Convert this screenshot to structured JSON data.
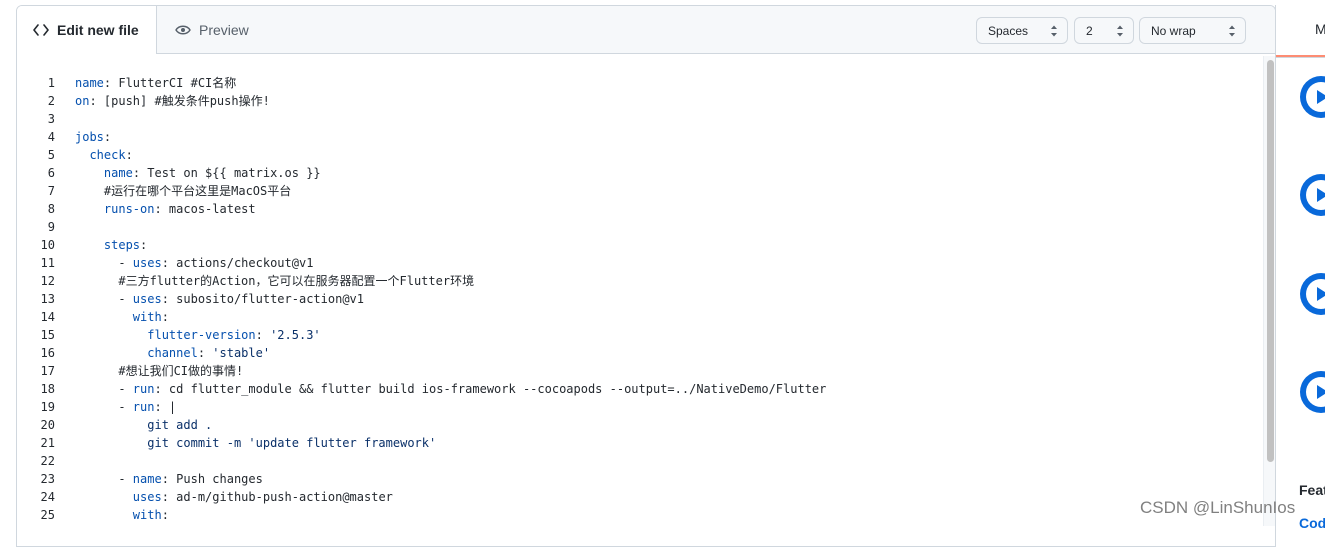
{
  "tabs": {
    "edit_label": "Edit new file",
    "preview_label": "Preview"
  },
  "options": {
    "indent_mode": "Spaces",
    "indent_size": "2",
    "wrap_mode": "No wrap"
  },
  "code_lines": [
    {
      "n": "1",
      "segs": [
        [
          "k",
          "name"
        ],
        [
          "t",
          ": FlutterCI #CI名称"
        ]
      ]
    },
    {
      "n": "2",
      "segs": [
        [
          "k",
          "on"
        ],
        [
          "t",
          ": [push] #触发条件push操作!"
        ]
      ]
    },
    {
      "n": "3",
      "segs": []
    },
    {
      "n": "4",
      "segs": [
        [
          "k",
          "jobs"
        ],
        [
          "t",
          ":"
        ]
      ]
    },
    {
      "n": "5",
      "segs": [
        [
          "t",
          "  "
        ],
        [
          "k",
          "check"
        ],
        [
          "t",
          ":"
        ]
      ]
    },
    {
      "n": "6",
      "segs": [
        [
          "t",
          "    "
        ],
        [
          "k",
          "name"
        ],
        [
          "t",
          ": Test on ${{ matrix.os }}"
        ]
      ]
    },
    {
      "n": "7",
      "segs": [
        [
          "t",
          "    #运行在哪个平台这里是MacOS平台"
        ]
      ]
    },
    {
      "n": "8",
      "segs": [
        [
          "t",
          "    "
        ],
        [
          "k",
          "runs-on"
        ],
        [
          "t",
          ": macos-latest"
        ]
      ]
    },
    {
      "n": "9",
      "segs": []
    },
    {
      "n": "10",
      "segs": [
        [
          "t",
          "    "
        ],
        [
          "k",
          "steps"
        ],
        [
          "t",
          ":"
        ]
      ]
    },
    {
      "n": "11",
      "segs": [
        [
          "t",
          "      - "
        ],
        [
          "k",
          "uses"
        ],
        [
          "t",
          ": actions/checkout@v1"
        ]
      ]
    },
    {
      "n": "12",
      "segs": [
        [
          "t",
          "      #三方flutter的Action，它可以在服务器配置一个Flutter环境"
        ]
      ]
    },
    {
      "n": "13",
      "segs": [
        [
          "t",
          "      - "
        ],
        [
          "k",
          "uses"
        ],
        [
          "t",
          ": subosito/flutter-action@v1"
        ]
      ]
    },
    {
      "n": "14",
      "segs": [
        [
          "t",
          "        "
        ],
        [
          "k",
          "with"
        ],
        [
          "t",
          ":"
        ]
      ]
    },
    {
      "n": "15",
      "segs": [
        [
          "t",
          "          "
        ],
        [
          "k",
          "flutter-version"
        ],
        [
          "t",
          ": "
        ],
        [
          "s",
          "'2.5.3'"
        ]
      ]
    },
    {
      "n": "16",
      "segs": [
        [
          "t",
          "          "
        ],
        [
          "k",
          "channel"
        ],
        [
          "t",
          ": "
        ],
        [
          "s",
          "'stable'"
        ]
      ]
    },
    {
      "n": "17",
      "segs": [
        [
          "t",
          "      #想让我们CI做的事情!"
        ]
      ]
    },
    {
      "n": "18",
      "segs": [
        [
          "t",
          "      - "
        ],
        [
          "k",
          "run"
        ],
        [
          "t",
          ": cd flutter_module && flutter build ios-framework --cocoapods --output=../NativeDemo/Flutter"
        ]
      ]
    },
    {
      "n": "19",
      "segs": [
        [
          "t",
          "      - "
        ],
        [
          "k",
          "run"
        ],
        [
          "t",
          ": |"
        ]
      ]
    },
    {
      "n": "20",
      "segs": [
        [
          "s",
          "          git add ."
        ]
      ]
    },
    {
      "n": "21",
      "segs": [
        [
          "s",
          "          git commit -m 'update flutter framework'"
        ]
      ]
    },
    {
      "n": "22",
      "segs": []
    },
    {
      "n": "23",
      "segs": [
        [
          "t",
          "      - "
        ],
        [
          "k",
          "name"
        ],
        [
          "t",
          ": Push changes"
        ]
      ]
    },
    {
      "n": "24",
      "segs": [
        [
          "t",
          "        "
        ],
        [
          "k",
          "uses"
        ],
        [
          "t",
          ": ad-m/github-push-action@master"
        ]
      ]
    },
    {
      "n": "25",
      "segs": [
        [
          "t",
          "        "
        ],
        [
          "k",
          "with"
        ],
        [
          "t",
          ":"
        ]
      ]
    }
  ],
  "sidebar": {
    "tab_label": "M",
    "section_heading": "Feat",
    "link_text": "Cod"
  },
  "watermark": "CSDN @LinShunIos",
  "colors": {
    "keyword": "#0550ae",
    "string": "#0a3069",
    "accent": "#0969da",
    "active_tab": "#fd8c73"
  }
}
